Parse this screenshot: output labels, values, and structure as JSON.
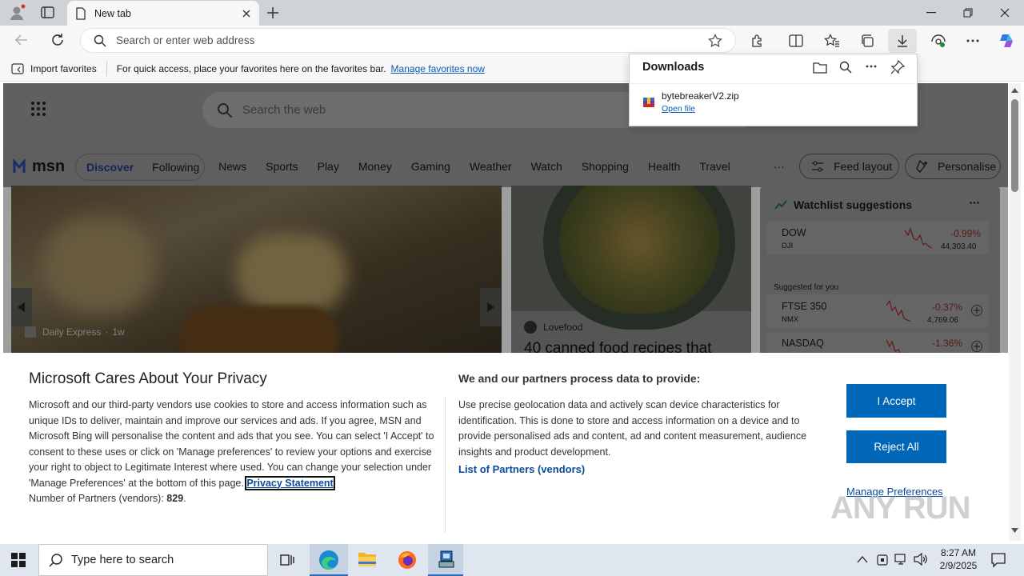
{
  "browser": {
    "tab_title": "New tab",
    "address_placeholder": "Search or enter web address",
    "favorites_bar": {
      "import_label": "Import favorites",
      "message": "For quick access, place your favorites here on the favorites bar.",
      "manage_link": "Manage favorites now"
    }
  },
  "downloads": {
    "title": "Downloads",
    "file_name": "bytebreakerV2.zip",
    "open_file_link": "Open file"
  },
  "msn": {
    "logo": "msn",
    "search_placeholder": "Search the web",
    "tabs": [
      "Discover",
      "Following"
    ],
    "nav": [
      "News",
      "Sports",
      "Play",
      "Money",
      "Gaming",
      "Weather",
      "Watch",
      "Shopping",
      "Health",
      "Travel"
    ],
    "more": "···",
    "feed_layout": "Feed layout",
    "personalise": "Personalise",
    "hero": {
      "source": "Daily Express",
      "age": "1w"
    },
    "food_card": {
      "source": "Lovefood",
      "headline": "40 canned food recipes that"
    },
    "watchlist": {
      "title": "Watchlist suggestions",
      "suggested_label": "Suggested for you",
      "items": [
        {
          "symbol": "DOW",
          "sub": "DJI",
          "change": "-0.99%",
          "value": "44,303.40"
        },
        {
          "symbol": "FTSE 350",
          "sub": "NMX",
          "change": "-0.37%",
          "value": "4,769.06"
        },
        {
          "symbol": "NASDAQ",
          "sub": "",
          "change": "-1.36%",
          "value": ""
        }
      ]
    }
  },
  "consent": {
    "title": "Microsoft Cares About Your Privacy",
    "body": "Microsoft and our third-party vendors use cookies to store and access information such as unique IDs to deliver, maintain and improve our services and ads. If you agree, MSN and Microsoft Bing will personalise the content and ads that you see. You can select 'I Accept' to consent to these uses or click on 'Manage preferences' to review your options and exercise your right to object to Legitimate Interest where used.  You can change your selection under 'Manage Preferences' at the bottom of this page.",
    "privacy_link": "Privacy Statement",
    "partners_label": "Number of Partners (vendors): ",
    "partners_count": "829",
    "partners_suffix": ".",
    "right_title": "We and our partners process data to provide:",
    "right_body": "Use precise geolocation data and actively scan device characteristics for identification. This is done to store and access information on a device and to provide personalised ads and content, ad and content measurement, audience insights and product development.",
    "vendors_link": "List of Partners (vendors)",
    "accept": "I Accept",
    "reject": "Reject All",
    "manage": "Manage Preferences"
  },
  "taskbar": {
    "search_placeholder": "Type here to search",
    "time": "8:27 AM",
    "date": "2/9/2025"
  },
  "watermark": "ANY RUN",
  "colors": {
    "accent": "#0067b8",
    "link": "#0a5ab4",
    "negative": "#c42b1c"
  }
}
